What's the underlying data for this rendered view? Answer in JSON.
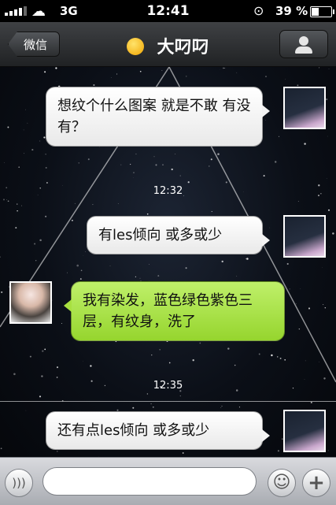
{
  "status_bar": {
    "carrier": "3G",
    "time": "12:41",
    "battery_percent_text": "39 %",
    "battery_level": 0.39,
    "icons": [
      "signal-icon",
      "cloud-icon",
      "rotation-lock-icon",
      "battery-icon"
    ]
  },
  "nav": {
    "back_label": "微信",
    "title": "大叼叼",
    "title_emoji": "smirk-emoji-icon",
    "profile_icon": "person-icon"
  },
  "messages": [
    {
      "side": "right",
      "style": "white",
      "text": "想纹个什么图案 就是不敢 有没有？"
    },
    {
      "type": "timestamp",
      "text": "12:32"
    },
    {
      "side": "right",
      "style": "white",
      "text": "有les倾向  或多或少"
    },
    {
      "side": "left",
      "style": "green",
      "text": "我有染发，蓝色绿色紫色三层，有纹身，洗了"
    },
    {
      "type": "timestamp",
      "text": "12:35"
    },
    {
      "side": "right",
      "style": "white",
      "text": "还有点les倾向 或多或少"
    }
  ],
  "input_bar": {
    "text_value": "",
    "icons": [
      "voice-icon",
      "smiley-icon",
      "plus-icon"
    ]
  },
  "colors": {
    "nav_bg": "#2b2d30",
    "white_bubble": "#f3f3f3",
    "green_bubble": "#a8e040",
    "input_bar_bg": "#c4c6cb"
  }
}
